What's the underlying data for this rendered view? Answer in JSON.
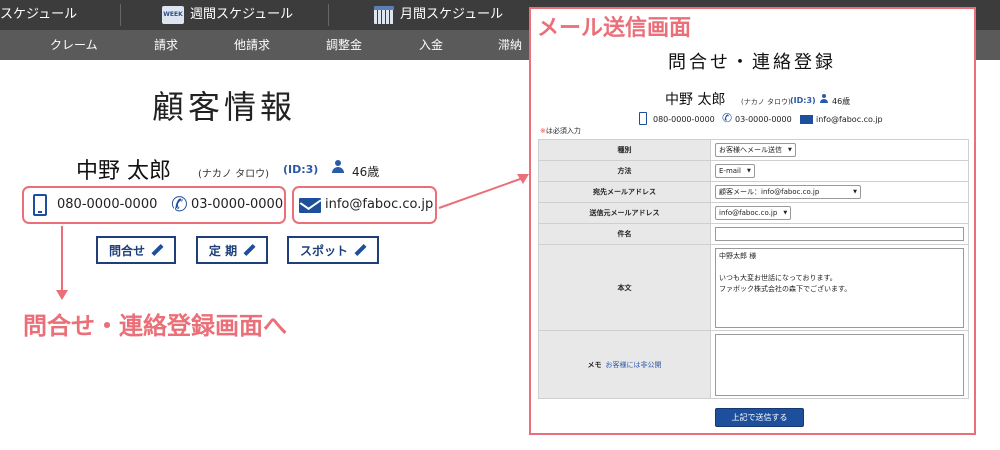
{
  "topbar": {
    "item1": "スケジュール",
    "week_icon": "WEEK",
    "item2": "週間スケジュール",
    "item3": "月間スケジュール"
  },
  "subnav": [
    "クレーム",
    "請求",
    "他請求",
    "調整金",
    "入金",
    "滞納"
  ],
  "customer": {
    "page_title": "顧客情報",
    "name": "中野 太郎",
    "kana": "(ナカノ タロウ)",
    "id": "(ID:3)",
    "age": "46歳",
    "mobile": "080-0000-0000",
    "tel": "03-0000-0000",
    "email": "info@faboc.co.jp"
  },
  "buttons": {
    "inquiry": "問合せ",
    "regular": "定 期",
    "spot": "スポット"
  },
  "annotations": {
    "left": "問合せ・連絡登録画面へ",
    "right": "メール送信画面"
  },
  "form": {
    "title": "問合せ・連絡登録",
    "required_note_mark": "※",
    "required_note": "は必須入力",
    "rows": {
      "type_label": "種別",
      "type_value": "お客様へメール送信",
      "method_label": "方法",
      "method_value": "E-mail",
      "to_label": "宛先メールアドレス",
      "to_value": "顧客メール：info@faboc.co.jp",
      "from_label": "送信元メールアドレス",
      "from_value": "info@faboc.co.jp",
      "subject_label": "件名",
      "body_label": "本文",
      "body_value": "中野太郎 様\n\nいつも大変お世話になっております。\nファボック株式会社の森下でございます。",
      "memo_label": "メモ",
      "memo_note": "お客様には非公開"
    },
    "submit": "上記で送信する"
  },
  "colors": {
    "annotation": "#ea6f78",
    "accent": "#1e4f9c"
  }
}
